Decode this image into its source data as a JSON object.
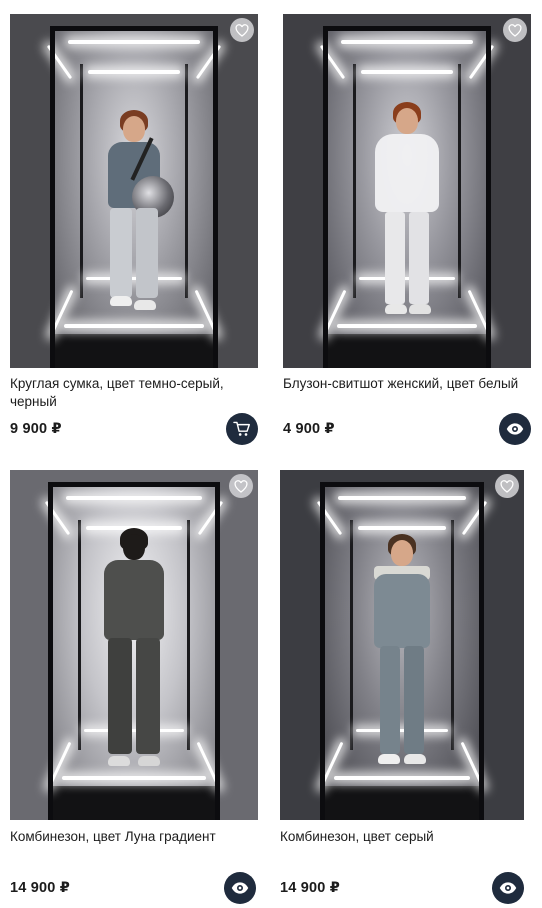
{
  "products": [
    {
      "title": "Круглая сумка, цвет темно-серый, черный",
      "price": "9 900 ₽",
      "favorite_icon": "heart-outline-icon",
      "action_icon": "cart-icon"
    },
    {
      "title": "Блузон-свитшот женский, цвет белый",
      "price": "4 900 ₽",
      "favorite_icon": "heart-outline-icon",
      "action_icon": "eye-icon"
    },
    {
      "title": "Комбинезон, цвет Луна градиент",
      "price": "14 900 ₽",
      "favorite_icon": "heart-outline-icon",
      "action_icon": "eye-icon"
    },
    {
      "title": "Комбинезон, цвет серый",
      "price": "14 900 ₽",
      "favorite_icon": "heart-outline-icon",
      "action_icon": "eye-icon"
    }
  ],
  "colors": {
    "action_button": "#1f2b3d",
    "text": "#1c1c1c",
    "favorite_button": "#cdcdd0"
  }
}
